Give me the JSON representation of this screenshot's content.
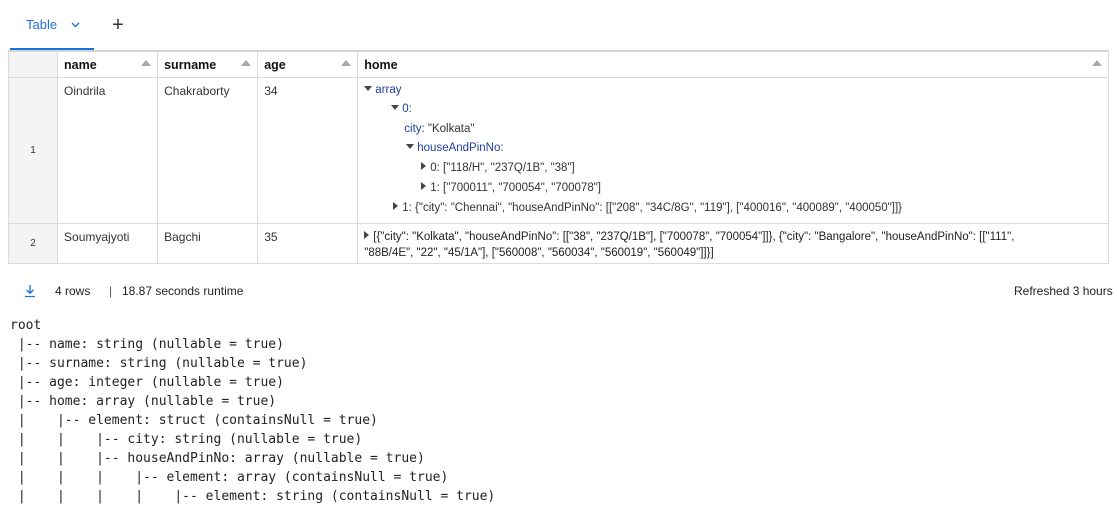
{
  "tab": {
    "label": "Table",
    "add_label": "+"
  },
  "table": {
    "headers": [
      "name",
      "surname",
      "age",
      "home"
    ],
    "rows": [
      {
        "index": "1",
        "name": "Oindrila",
        "surname": "Chakraborty",
        "age": "34",
        "home_tree": {
          "root": "array",
          "item0": "0:",
          "city_key": "city:",
          "city_val": " \"Kolkata\"",
          "house_key": "houseAndPinNo:",
          "house0": "0: [\"118/H\", \"237Q/1B\", \"38\"]",
          "house1": "1: [\"700011\", \"700054\", \"700078\"]",
          "item1": "1: {\"city\": \"Chennai\", \"houseAndPinNo\": [[\"208\", \"34C/8G\", \"119\"], [\"400016\", \"400089\", \"400050\"]]}"
        }
      },
      {
        "index": "2",
        "name": "Soumyajyoti",
        "surname": "Bagchi",
        "age": "35",
        "home_line1": "[{\"city\": \"Kolkata\", \"houseAndPinNo\": [[\"38\", \"237Q/1B\"], [\"700078\", \"700054\"]]}, {\"city\": \"Bangalore\", \"houseAndPinNo\": [[\"111\",",
        "home_line2": "\"88B/4E\", \"22\", \"45/1A\"], [\"560008\", \"560034\", \"560019\", \"560049\"]]}]"
      }
    ]
  },
  "footer": {
    "rows": "4 rows",
    "separator": "|",
    "runtime": "18.87 seconds runtime",
    "refreshed": "Refreshed 3 hours"
  },
  "schema": [
    "root",
    " |-- name: string (nullable = true)",
    " |-- surname: string (nullable = true)",
    " |-- age: integer (nullable = true)",
    " |-- home: array (nullable = true)",
    " |    |-- element: struct (containsNull = true)",
    " |    |    |-- city: string (nullable = true)",
    " |    |    |-- houseAndPinNo: array (nullable = true)",
    " |    |    |    |-- element: array (containsNull = true)",
    " |    |    |    |    |-- element: string (containsNull = true)"
  ],
  "colors": {
    "accent": "#1a73d9",
    "key": "#1f3f9f",
    "border": "#dadada"
  }
}
